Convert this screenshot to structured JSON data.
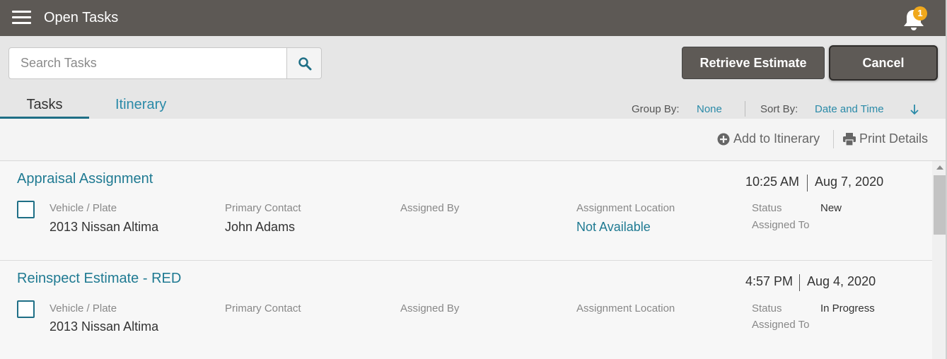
{
  "header": {
    "title": "Open Tasks",
    "notification_count": "1"
  },
  "search": {
    "placeholder": "Search Tasks"
  },
  "actions": {
    "retrieve_label": "Retrieve Estimate",
    "cancel_label": "Cancel"
  },
  "tabs": [
    {
      "label": "Tasks",
      "active": true
    },
    {
      "label": "Itinerary",
      "active": false
    }
  ],
  "toolbar": {
    "group_by_label": "Group By:",
    "group_by_value": "None",
    "sort_by_label": "Sort By:",
    "sort_by_value": "Date and Time"
  },
  "action_bar": {
    "add_itinerary": "Add to Itinerary",
    "print_details": "Print Details"
  },
  "labels": {
    "vehicle": "Vehicle / Plate",
    "contact": "Primary Contact",
    "assigned_by": "Assigned By",
    "location": "Assignment Location",
    "status": "Status",
    "assigned_to": "Assigned To"
  },
  "tasks": [
    {
      "title": "Appraisal Assignment",
      "time": "10:25 AM",
      "date": "Aug 7, 2020",
      "vehicle": "2013 Nissan Altima",
      "contact": "John Adams",
      "location": "Not Available",
      "status": "New"
    },
    {
      "title": "Reinspect Estimate - RED",
      "time": "4:57 PM",
      "date": "Aug 4, 2020",
      "vehicle": "2013 Nissan Altima",
      "contact": "",
      "location": "",
      "status": "In Progress"
    }
  ],
  "colors": {
    "header_bg": "#5d5955",
    "accent": "#1f7a92",
    "link": "#2a8aa8",
    "badge": "#f0a81c"
  }
}
